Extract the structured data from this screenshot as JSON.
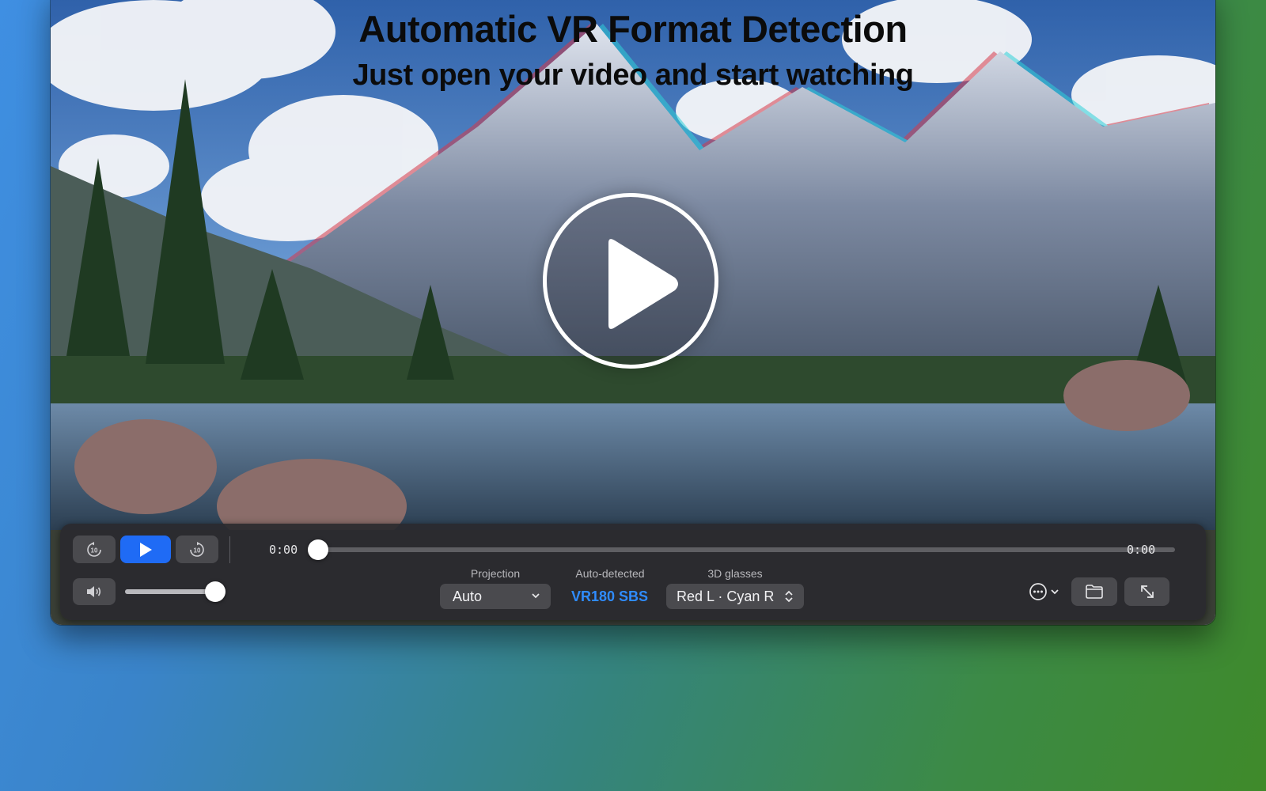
{
  "headline": {
    "title": "Automatic VR Format Detection",
    "subtitle": "Just open your video and start watching"
  },
  "player": {
    "current_time": "0:00",
    "duration": "0:00",
    "progress": 0,
    "volume": 1.0,
    "skip_back_seconds": "10",
    "skip_forward_seconds": "10"
  },
  "projection": {
    "label": "Projection",
    "value": "Auto"
  },
  "detected": {
    "label": "Auto-detected",
    "value": "VR180 SBS"
  },
  "glasses": {
    "label": "3D glasses",
    "value": "Red L · Cyan R"
  },
  "colors": {
    "accent": "#1f6bf5",
    "detected_text": "#2f8cff"
  },
  "icons": {
    "skip_back": "skip-back-10-icon",
    "play": "play-icon",
    "skip_forward": "skip-forward-10-icon",
    "volume": "speaker-icon",
    "more": "ellipsis-circle-icon",
    "open": "folder-icon",
    "fullscreen": "expand-arrows-icon"
  }
}
